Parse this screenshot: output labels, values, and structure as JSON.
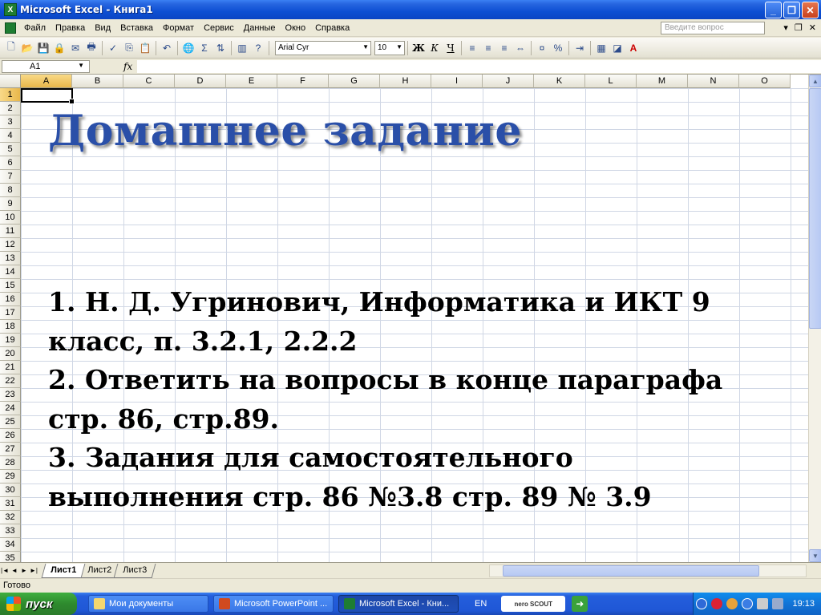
{
  "window": {
    "title": "Microsoft Excel - Книга1",
    "app_icon": "excel-icon"
  },
  "menu": {
    "items": [
      "Файл",
      "Правка",
      "Вид",
      "Вставка",
      "Формат",
      "Сервис",
      "Данные",
      "Окно",
      "Справка"
    ],
    "ask_placeholder": "Введите вопрос"
  },
  "toolbar": {
    "font_name": "Arial Cyr",
    "font_size": "10",
    "bold": "Ж",
    "italic": "К",
    "underline": "Ч",
    "percent": "%",
    "sum": "Σ"
  },
  "formula_bar": {
    "cell_ref": "A1",
    "fx": "fx",
    "content": ""
  },
  "grid": {
    "columns": [
      "A",
      "B",
      "C",
      "D",
      "E",
      "F",
      "G",
      "H",
      "I",
      "J",
      "K",
      "L",
      "M",
      "N",
      "O"
    ],
    "rows": [
      "1",
      "2",
      "3",
      "4",
      "5",
      "6",
      "7",
      "8",
      "9",
      "10",
      "11",
      "12",
      "13",
      "14",
      "15",
      "16",
      "17",
      "18",
      "19",
      "20",
      "21",
      "22",
      "23",
      "24",
      "25",
      "26",
      "27",
      "28",
      "29",
      "30",
      "31",
      "32",
      "33",
      "34",
      "35"
    ],
    "active_cell": "A1"
  },
  "content": {
    "title": "Домашнее задание",
    "lines": [
      "1. Н. Д. Угринович, Информатика и ИКТ 9",
      "класс, п. 3.2.1, 2.2.2",
      "2. Ответить на вопросы в конце параграфа",
      "стр. 86, стр.89.",
      "3. Задания для самостоятельного",
      "выполнения стр. 86 №3.8 стр. 89 № 3.9"
    ]
  },
  "sheets": {
    "tabs": [
      "Лист1",
      "Лист2",
      "Лист3"
    ],
    "active": "Лист1"
  },
  "status": {
    "text": "Готово"
  },
  "taskbar": {
    "start_label": "пуск",
    "tasks": [
      "Мои документы",
      "Microsoft PowerPoint ...",
      "Microsoft Excel - Кни..."
    ],
    "active_task": 2,
    "language": "EN",
    "nero_label": "nero SCOUT",
    "clock": "19:13"
  },
  "colors": {
    "title_blue": "#2a4fa8",
    "taskbar_blue": "#245edc",
    "start_green": "#3fae3f"
  }
}
